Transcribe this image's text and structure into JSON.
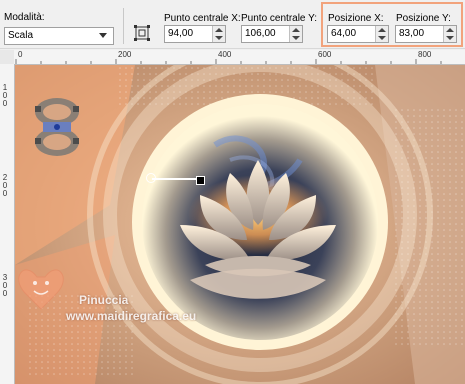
{
  "toolbar": {
    "mode": {
      "label": "Modalità:",
      "value": "Scala"
    },
    "center_x": {
      "label": "Punto centrale X:",
      "value": "94,00"
    },
    "center_y": {
      "label": "Punto centrale Y:",
      "value": "106,00"
    },
    "pos_x": {
      "label": "Posizione X:",
      "value": "64,00"
    },
    "pos_y": {
      "label": "Posizione Y:",
      "value": "83,00"
    }
  },
  "ruler": {
    "top_ticks": [
      "0",
      "200",
      "400",
      "600",
      "800"
    ],
    "left_ticks": [
      "1",
      "0",
      "0",
      "2",
      "0",
      "0",
      "3",
      "0",
      "0",
      "4",
      "0",
      "0"
    ]
  },
  "watermark": {
    "name": "Pinuccia",
    "url": "www.maidiregrafica.eu"
  },
  "colors": {
    "highlight": "#f2a37c",
    "peach": "#f5b98c"
  }
}
